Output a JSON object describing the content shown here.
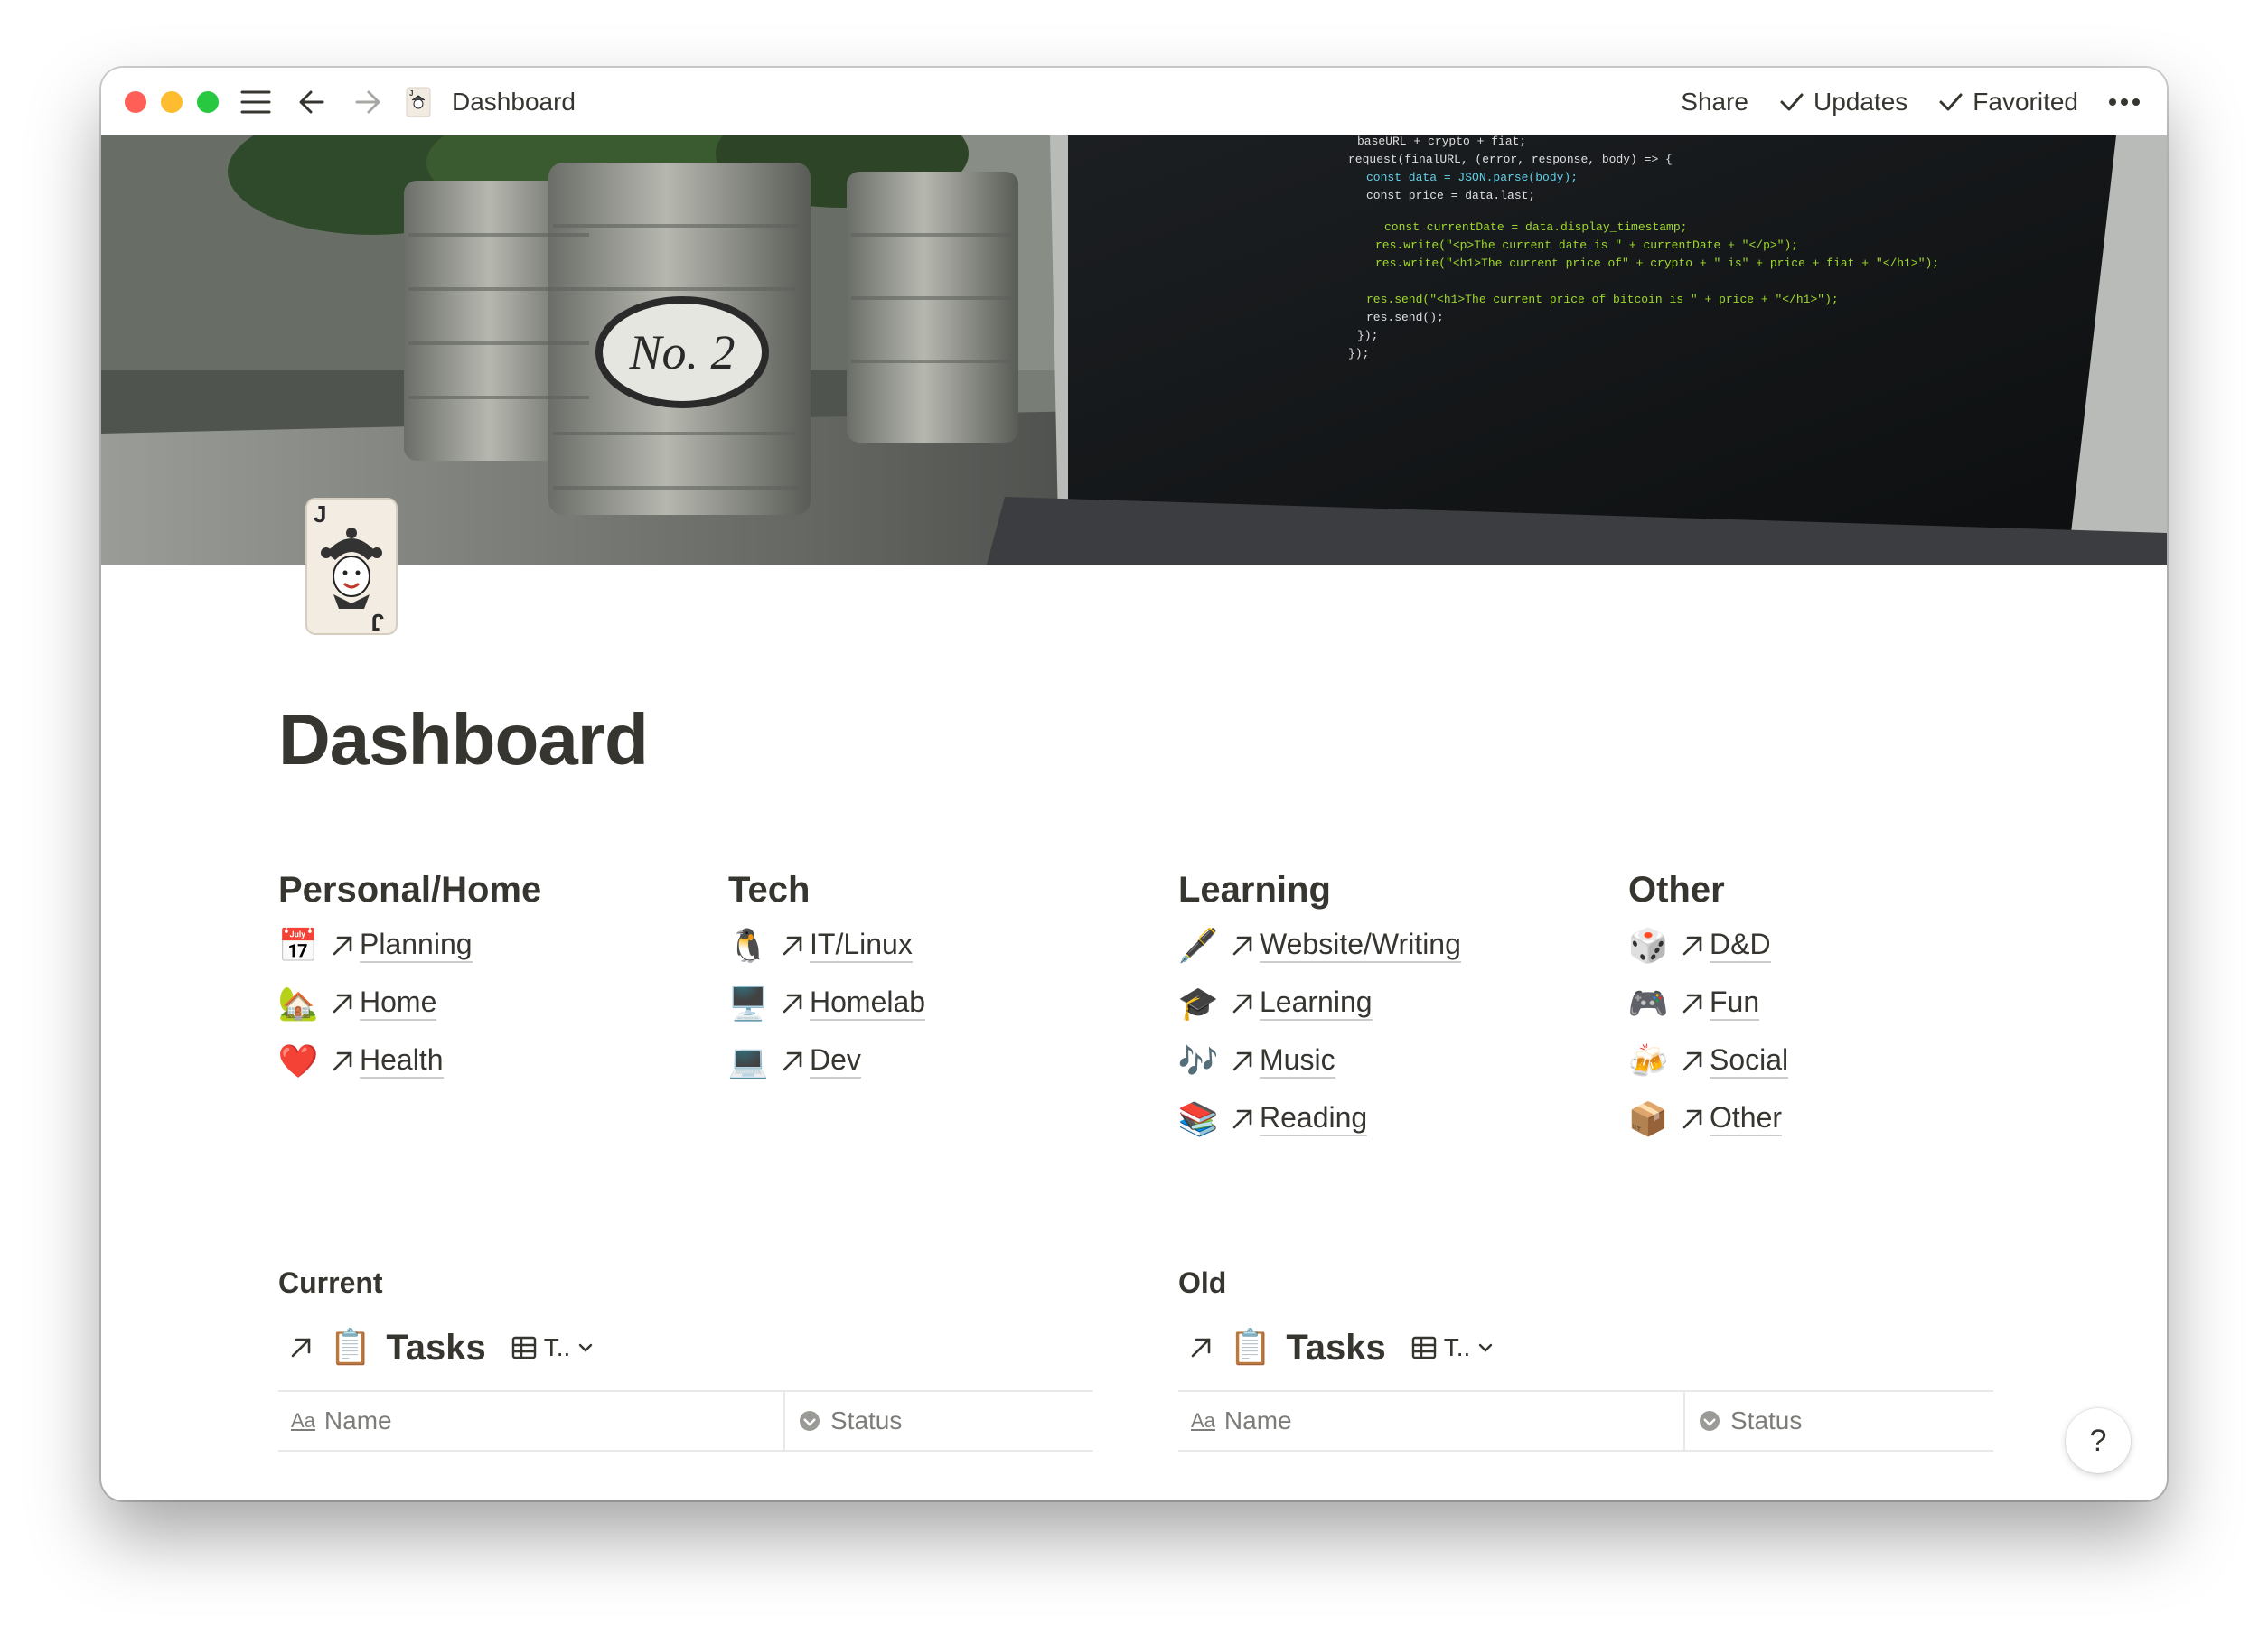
{
  "titlebar": {
    "title": "Dashboard",
    "actions": {
      "share": "Share",
      "updates": "Updates",
      "favorited": "Favorited"
    }
  },
  "cover": {
    "description_icons": [
      "plant-pots-photo",
      "laptop-code-photo"
    ],
    "pot_label": "No. 2"
  },
  "page": {
    "title": "Dashboard"
  },
  "sections": [
    {
      "heading": "Personal/Home",
      "links": [
        {
          "emoji": "📅",
          "label": "Planning"
        },
        {
          "emoji": "🏡",
          "label": "Home"
        },
        {
          "emoji": "❤️",
          "label": "Health"
        }
      ]
    },
    {
      "heading": "Tech",
      "links": [
        {
          "emoji": "🐧",
          "label": "IT/Linux"
        },
        {
          "emoji": "🖥️",
          "label": "Homelab"
        },
        {
          "emoji": "💻",
          "label": "Dev"
        }
      ]
    },
    {
      "heading": "Learning",
      "links": [
        {
          "emoji": "🖋️",
          "label": "Website/Writing"
        },
        {
          "emoji": "🎓",
          "label": "Learning"
        },
        {
          "emoji": "🎶",
          "label": "Music"
        },
        {
          "emoji": "📚",
          "label": "Reading"
        }
      ]
    },
    {
      "heading": "Other",
      "links": [
        {
          "emoji": "🎲",
          "label": "D&D"
        },
        {
          "emoji": "🎮",
          "label": "Fun"
        },
        {
          "emoji": "🍻",
          "label": "Social"
        },
        {
          "emoji": "📦",
          "label": "Other"
        }
      ]
    }
  ],
  "databases": [
    {
      "heading": "Current",
      "emoji": "📋",
      "title": "Tasks",
      "view": "T..",
      "columns": {
        "name": "Name",
        "status": "Status"
      },
      "name_icon": "Aa"
    },
    {
      "heading": "Old",
      "emoji": "📋",
      "title": "Tasks",
      "view": "T..",
      "columns": {
        "name": "Name",
        "status": "Status"
      },
      "name_icon": "Aa"
    }
  ],
  "help": {
    "label": "?"
  },
  "colors": {
    "text": "#37352f",
    "accent_red": "#ff5f57",
    "accent_yellow": "#febc2e",
    "accent_green": "#28c840"
  }
}
